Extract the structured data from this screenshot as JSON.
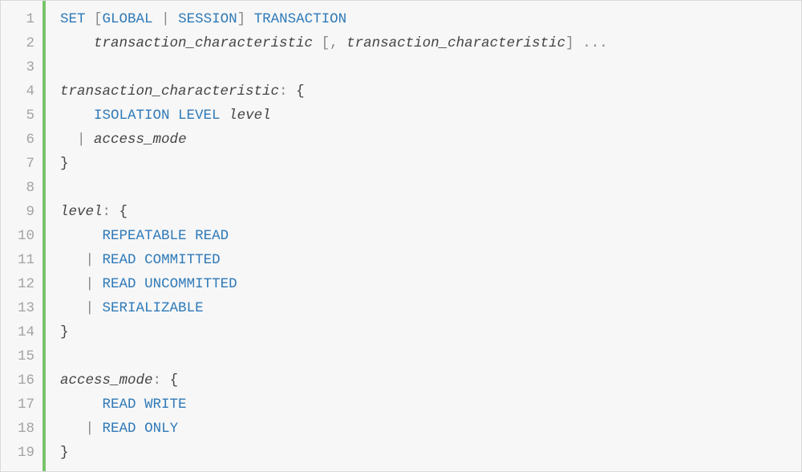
{
  "lineNumbers": [
    "1",
    "2",
    "3",
    "4",
    "5",
    "6",
    "7",
    "8",
    "9",
    "10",
    "11",
    "12",
    "13",
    "14",
    "15",
    "16",
    "17",
    "18",
    "19"
  ],
  "tokens": [
    [
      {
        "t": "SET",
        "c": "kw"
      },
      {
        "t": " "
      },
      {
        "t": "[",
        "c": "pun"
      },
      {
        "t": "GLOBAL",
        "c": "kw"
      },
      {
        "t": " "
      },
      {
        "t": "|",
        "c": "bar"
      },
      {
        "t": " "
      },
      {
        "t": "SESSION",
        "c": "kw"
      },
      {
        "t": "]",
        "c": "pun"
      },
      {
        "t": " "
      },
      {
        "t": "TRANSACTION",
        "c": "kw"
      }
    ],
    [
      {
        "t": "    "
      },
      {
        "t": "transaction_characteristic",
        "c": "ital"
      },
      {
        "t": " "
      },
      {
        "t": "[",
        "c": "pun"
      },
      {
        "t": ",",
        "c": "pun"
      },
      {
        "t": " "
      },
      {
        "t": "transaction_characteristic",
        "c": "ital"
      },
      {
        "t": "]",
        "c": "pun"
      },
      {
        "t": " "
      },
      {
        "t": "...",
        "c": "pun"
      }
    ],
    [],
    [
      {
        "t": "transaction_characteristic",
        "c": "ital"
      },
      {
        "t": ":",
        "c": "pun"
      },
      {
        "t": " "
      },
      {
        "t": "{",
        "c": "brace"
      }
    ],
    [
      {
        "t": "    "
      },
      {
        "t": "ISOLATION",
        "c": "kw"
      },
      {
        "t": " "
      },
      {
        "t": "LEVEL",
        "c": "kw"
      },
      {
        "t": " "
      },
      {
        "t": "level",
        "c": "ital"
      }
    ],
    [
      {
        "t": "  "
      },
      {
        "t": "|",
        "c": "bar"
      },
      {
        "t": " "
      },
      {
        "t": "access_mode",
        "c": "ital"
      }
    ],
    [
      {
        "t": "}",
        "c": "brace"
      }
    ],
    [],
    [
      {
        "t": "level",
        "c": "ital"
      },
      {
        "t": ":",
        "c": "pun"
      },
      {
        "t": " "
      },
      {
        "t": "{",
        "c": "brace"
      }
    ],
    [
      {
        "t": "     "
      },
      {
        "t": "REPEATABLE",
        "c": "kw"
      },
      {
        "t": " "
      },
      {
        "t": "READ",
        "c": "kw"
      }
    ],
    [
      {
        "t": "   "
      },
      {
        "t": "|",
        "c": "bar"
      },
      {
        "t": " "
      },
      {
        "t": "READ",
        "c": "kw"
      },
      {
        "t": " "
      },
      {
        "t": "COMMITTED",
        "c": "kw"
      }
    ],
    [
      {
        "t": "   "
      },
      {
        "t": "|",
        "c": "bar"
      },
      {
        "t": " "
      },
      {
        "t": "READ",
        "c": "kw"
      },
      {
        "t": " "
      },
      {
        "t": "UNCOMMITTED",
        "c": "kw"
      }
    ],
    [
      {
        "t": "   "
      },
      {
        "t": "|",
        "c": "bar"
      },
      {
        "t": " "
      },
      {
        "t": "SERIALIZABLE",
        "c": "kw"
      }
    ],
    [
      {
        "t": "}",
        "c": "brace"
      }
    ],
    [],
    [
      {
        "t": "access_mode",
        "c": "ital"
      },
      {
        "t": ":",
        "c": "pun"
      },
      {
        "t": " "
      },
      {
        "t": "{",
        "c": "brace"
      }
    ],
    [
      {
        "t": "     "
      },
      {
        "t": "READ",
        "c": "kw"
      },
      {
        "t": " "
      },
      {
        "t": "WRITE",
        "c": "kw"
      }
    ],
    [
      {
        "t": "   "
      },
      {
        "t": "|",
        "c": "bar"
      },
      {
        "t": " "
      },
      {
        "t": "READ",
        "c": "kw"
      },
      {
        "t": " "
      },
      {
        "t": "ONLY",
        "c": "kw"
      }
    ],
    [
      {
        "t": "}",
        "c": "brace"
      }
    ]
  ]
}
